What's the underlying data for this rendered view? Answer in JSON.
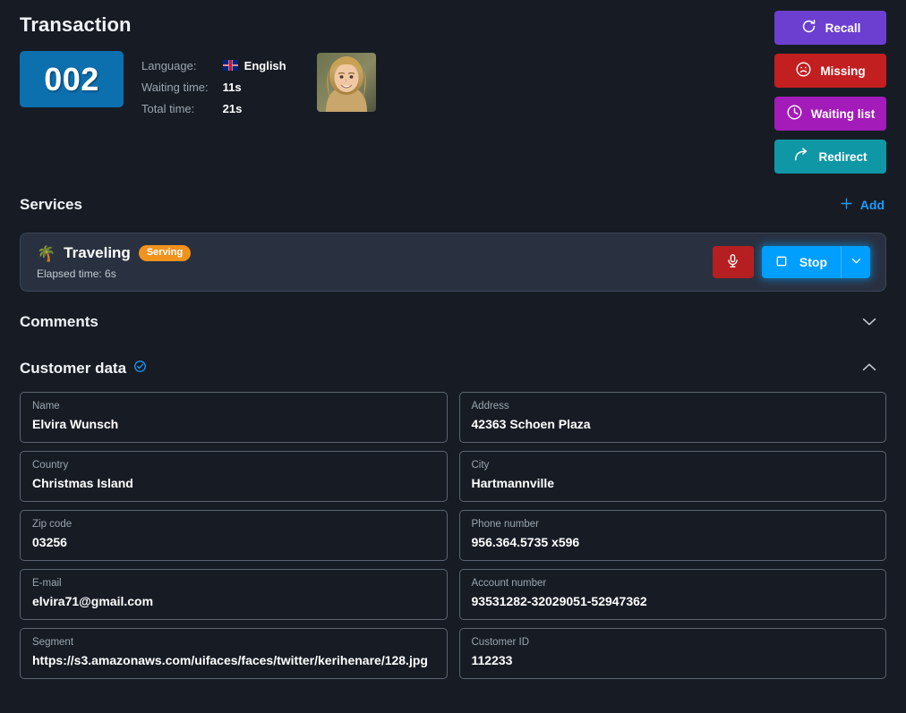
{
  "header": {
    "title": "Transaction",
    "ticket_number": "002",
    "meta": [
      {
        "key": "Language:",
        "value": "English",
        "flag": "uk-flag-icon"
      },
      {
        "key": "Waiting time:",
        "value": "11s"
      },
      {
        "key": "Total time:",
        "value": "21s"
      }
    ],
    "avatar_alt": "customer-photo"
  },
  "actions": [
    {
      "label": "Recall",
      "icon": "refresh-icon",
      "color": "#6c3fd0",
      "name": "recall-button"
    },
    {
      "label": "Missing",
      "icon": "sad-face-icon",
      "color": "#c21f21",
      "name": "missing-button"
    },
    {
      "label": "Waiting list",
      "icon": "clock-icon",
      "color": "#a31bb8",
      "name": "waiting-list-button"
    },
    {
      "label": "Redirect",
      "icon": "arrow-redirect-icon",
      "color": "#0f97a6",
      "name": "redirect-button"
    }
  ],
  "services": {
    "title": "Services",
    "add_label": "Add",
    "add_icon": "plus-icon",
    "item": {
      "emoji": "🌴",
      "name": "Traveling",
      "status_badge": "Serving",
      "elapsed": "Elapsed time: 6s",
      "mic_icon": "microphone-icon",
      "stop_label": "Stop",
      "stop_icon": "stop-square-icon",
      "caret_icon": "chevron-down-icon"
    }
  },
  "comments": {
    "title": "Comments",
    "chevron": "chevron-down-icon"
  },
  "customer_data": {
    "title": "Customer data",
    "verified_icon": "check-circle-icon",
    "chevron": "chevron-up-icon",
    "fields": [
      {
        "label": "Name",
        "value": "Elvira Wunsch"
      },
      {
        "label": "Address",
        "value": "42363 Schoen Plaza"
      },
      {
        "label": "Country",
        "value": "Christmas Island"
      },
      {
        "label": "City",
        "value": "Hartmannville"
      },
      {
        "label": "Zip code",
        "value": "03256"
      },
      {
        "label": "Phone number",
        "value": "956.364.5735 x596"
      },
      {
        "label": "E-mail",
        "value": "elvira71@gmail.com"
      },
      {
        "label": "Account number",
        "value": "93531282-32029051-52947362"
      },
      {
        "label": "Segment",
        "value": "https://s3.amazonaws.com/uifaces/faces/twitter/kerihenare/128.jpg"
      },
      {
        "label": "Customer ID",
        "value": "112233"
      }
    ]
  },
  "colors": {
    "background": "#171c24",
    "ticket_badge": "#0c6fae",
    "accent_blue": "#1a9cfc",
    "stop_blue": "#009efd",
    "serving_orange": "#f0921e",
    "mic_red": "#b51f21"
  }
}
